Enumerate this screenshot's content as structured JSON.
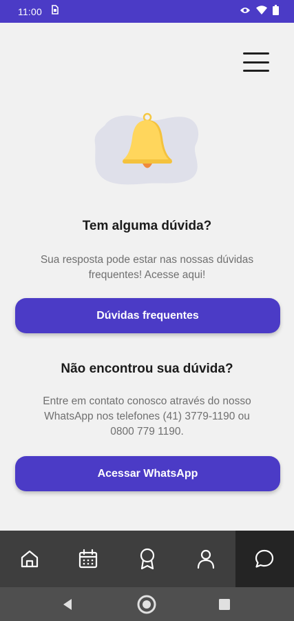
{
  "status_bar": {
    "time": "11:00",
    "icons": [
      "sim-card-icon",
      "eye-icon",
      "wifi-icon",
      "battery-icon"
    ]
  },
  "header": {
    "menu_icon": "hamburger-menu-icon"
  },
  "illustration": {
    "icon": "bell-icon"
  },
  "faq_section": {
    "title": "Tem alguma dúvida?",
    "line1": "Sua resposta pode estar nas nossas dúvidas",
    "line2": "frequentes! Acesse aqui!",
    "button_label": "Dúvidas frequentes"
  },
  "contact_section": {
    "title": "Não encontrou sua dúvida?",
    "line1": "Entre em contato conosco através do nosso",
    "line2": "WhatsApp nos telefones (41) 3779-1190 ou",
    "line3": "0800 779 1190.",
    "button_label": "Acessar WhatsApp"
  },
  "bottom_nav": {
    "items": [
      "home-icon",
      "calendar-icon",
      "award-icon",
      "profile-icon",
      "chat-icon"
    ],
    "active": "chat-icon"
  },
  "system_nav": {
    "buttons": [
      "back-icon",
      "home-circle-icon",
      "recents-icon"
    ]
  },
  "colors": {
    "primary": "#4b3bc6",
    "background": "#f1f1f1",
    "nav_background": "#3e3e3e",
    "nav_active": "#242424",
    "bell": "#ffd65c"
  }
}
